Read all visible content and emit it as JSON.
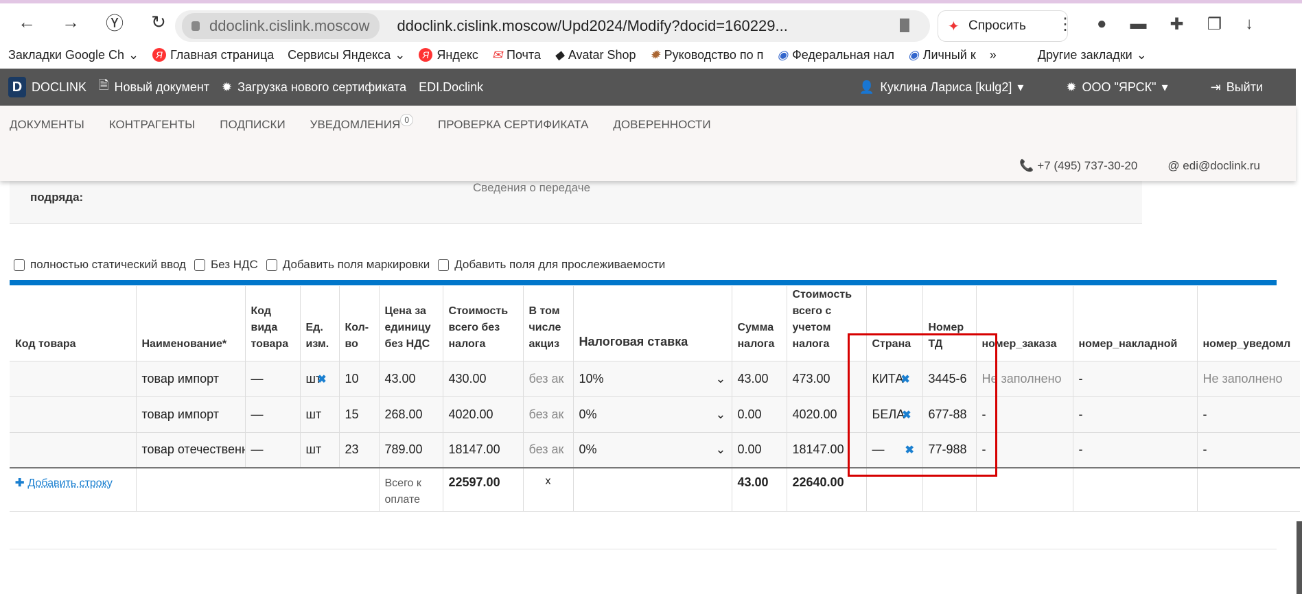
{
  "browser": {
    "domain": "ddoclink.cislink.moscow",
    "url": "ddoclink.cislink.moscow/Upd2024/Modify?docid=160229...",
    "ask": "Спросить"
  },
  "bookmarks": [
    "Закладки Google Ch",
    "Главная страница",
    "Сервисы Яндекса",
    "Яндекс",
    "Почта",
    "Avatar Shop",
    "Руководство по п",
    "Федеральная нал",
    "Личный к",
    "»",
    "Другие закладки"
  ],
  "nav": {
    "logo": "DOCLINK",
    "new_doc": "Новый документ",
    "upload_cert": "Загрузка нового сертификата",
    "edi": "EDI.Doclink",
    "user": "Куклина Лариса [kulg2]",
    "org": "ООО \"ЯРСК\"",
    "logout": "Выйти"
  },
  "tabs": [
    "ДОКУМЕНТЫ",
    "КОНТРАГЕНТЫ",
    "ПОДПИСКИ",
    "УВЕДОМЛЕНИЯ",
    "ПРОВЕРКА СЕРТИФИКАТА",
    "ДОВЕРЕННОСТИ"
  ],
  "notif_count": "0",
  "contact": {
    "phone": "+7 (495) 737-30-20",
    "email": "edi@doclink.ru"
  },
  "partial": {
    "label": "подряда:",
    "value": "Сведения о передаче"
  },
  "checks": [
    "полностью статический ввод",
    "Без НДС",
    "Добавить поля маркировки",
    "Добавить поля для прослеживаемости"
  ],
  "headers": [
    "Код товара",
    "Наименование*",
    "Код вида товара",
    "Ед. изм.",
    "Кол-во",
    "Цена за единицу без НДС",
    "Стоимость всего без налога",
    "В том числе акциз",
    "Налоговая ставка",
    "Сумма налога",
    "Стоимость всего с учетом налога",
    "Страна",
    "Номер ТД",
    "номер_заказа",
    "номер_накладной",
    "номер_уведомл"
  ],
  "rows": [
    {
      "code": "",
      "name": "товар импорт",
      "kind": "—",
      "unit": "шт",
      "qty": "10",
      "price": "43.00",
      "cost": "430.00",
      "excise": "без ак",
      "rate": "10%",
      "tax": "43.00",
      "total": "473.00",
      "country": "КИТА",
      "td": "3445-6",
      "order": "Не заполнено",
      "invoice": "-",
      "notice": "Не заполнено"
    },
    {
      "code": "",
      "name": "товар импорт",
      "kind": "—",
      "unit": "шт",
      "qty": "15",
      "price": "268.00",
      "cost": "4020.00",
      "excise": "без ак",
      "rate": "0%",
      "tax": "0.00",
      "total": "4020.00",
      "country": "БЕЛА",
      "td": "677-88",
      "order": "-",
      "invoice": "-",
      "notice": "-"
    },
    {
      "code": "",
      "name": "товар отечественный",
      "kind": "—",
      "unit": "шт",
      "qty": "23",
      "price": "789.00",
      "cost": "18147.00",
      "excise": "без ак",
      "rate": "0%",
      "tax": "0.00",
      "total": "18147.00",
      "country": "—",
      "td": "77-988",
      "order": "-",
      "invoice": "-",
      "notice": "-"
    }
  ],
  "footer": {
    "add_row": "Добавить строку",
    "total_label": "Всего к оплате",
    "cost_total": "22597.00",
    "excise": "x",
    "tax_total": "43.00",
    "grand_total": "22640.00"
  },
  "accent": "#0076ca",
  "highlight": "#d60000"
}
